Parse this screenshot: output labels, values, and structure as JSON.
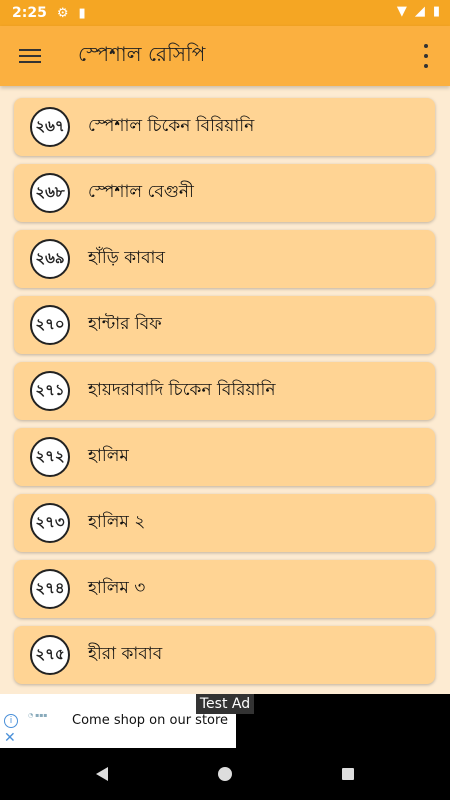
{
  "status_bar": {
    "time": "2:25"
  },
  "app_bar": {
    "title": "স্পেশাল রেসিপি"
  },
  "items": [
    {
      "num": "২৬৭",
      "label": "স্পেশাল চিকেন বিরিয়ানি"
    },
    {
      "num": "২৬৮",
      "label": "স্পেশাল বেগুনী"
    },
    {
      "num": "২৬৯",
      "label": "হাঁড়ি কাবাব"
    },
    {
      "num": "২৭০",
      "label": "হান্টার বিফ"
    },
    {
      "num": "২৭১",
      "label": "হায়দরাবাদি চিকেন বিরিয়ানি"
    },
    {
      "num": "২৭২",
      "label": "হালিম"
    },
    {
      "num": "২৭৩",
      "label": "হালিম ২"
    },
    {
      "num": "২৭৪",
      "label": "হালিম ৩"
    },
    {
      "num": "২৭৫",
      "label": "হীরা কাবাব"
    }
  ],
  "ad": {
    "badge": "Test Ad",
    "text": "Come shop on our store"
  },
  "colors": {
    "appbar": "#fbb040",
    "statusbar": "#f5a623",
    "item_bg": "#ffd494",
    "page_bg": "#fdebd2"
  }
}
